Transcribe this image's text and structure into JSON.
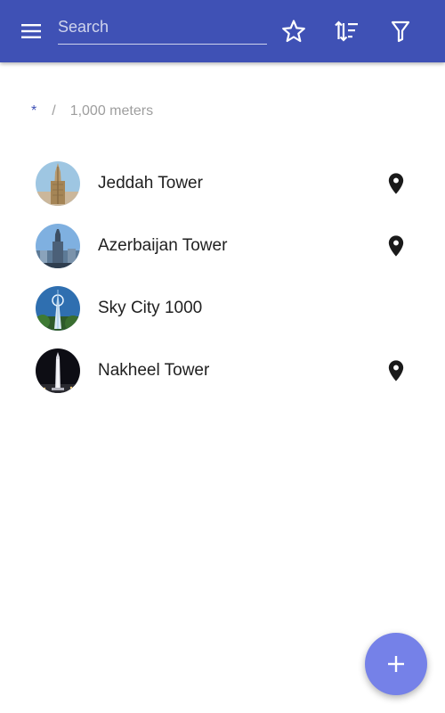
{
  "toolbar": {
    "background": "#3f51b5",
    "menu_icon": "menu-icon",
    "search": {
      "value": "",
      "placeholder": "Search"
    },
    "favorite_icon": "star-outline-icon",
    "sort_icon": "sort-icon",
    "filter_icon": "filter-icon"
  },
  "breadcrumb": {
    "root": "*",
    "separator": "/",
    "current": "1,000 meters"
  },
  "towers": [
    {
      "name": "Jeddah Tower",
      "has_location": true,
      "location_icon": "map-pin-icon"
    },
    {
      "name": "Azerbaijan Tower",
      "has_location": true,
      "location_icon": "map-pin-icon"
    },
    {
      "name": "Sky City 1000",
      "has_location": false
    },
    {
      "name": "Nakheel Tower",
      "has_location": true,
      "location_icon": "map-pin-icon"
    }
  ],
  "fab": {
    "icon": "plus-icon",
    "color": "#7581e8"
  },
  "colors": {
    "accent": "#3f51b5",
    "text_primary": "#212121",
    "text_secondary": "#9e9e9e"
  }
}
